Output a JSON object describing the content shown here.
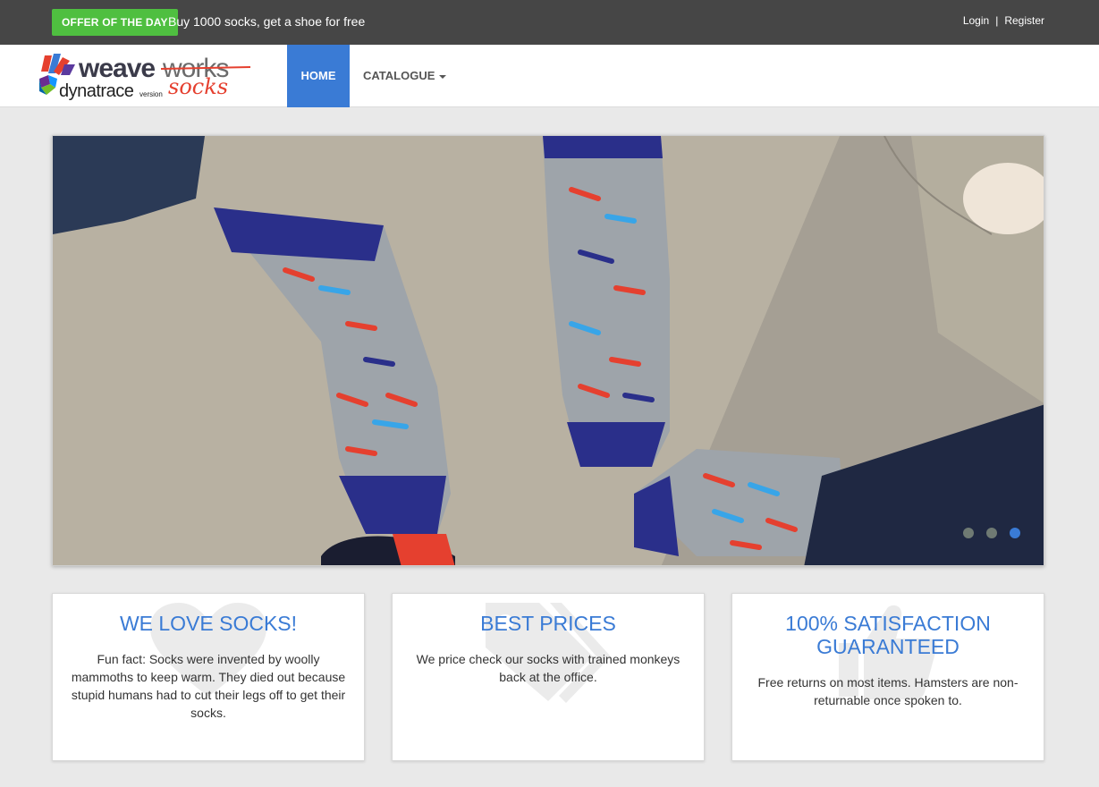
{
  "topbar": {
    "offer_label": "Offer of the day",
    "offer_text": "Buy 1000 socks, get a shoe for free",
    "login": "Login",
    "separator": "|",
    "register": "Register"
  },
  "logo": {
    "brand": "weave",
    "brand_accent": "works",
    "partner": "dynatrace",
    "partner_suffix": "version",
    "product": "socks"
  },
  "nav": {
    "home": "Home",
    "catalogue": "Catalogue"
  },
  "carousel": {
    "slide_count": 3,
    "active_slide": 3
  },
  "features": [
    {
      "title": "We love socks!",
      "text": "Fun fact: Socks were invented by woolly mammoths to keep warm. They died out because stupid humans had to cut their legs off to get their socks.",
      "icon": "heart-icon"
    },
    {
      "title": "Best prices",
      "text": "We price check our socks with trained monkeys back at the office.",
      "icon": "tags-icon"
    },
    {
      "title": "100% satisfaction guaranteed",
      "text": "Free returns on most items. Hamsters are non-returnable once spoken to.",
      "icon": "thumbs-up-icon"
    }
  ],
  "colors": {
    "accent": "#3a7bd5",
    "offer": "#4fbf40",
    "topbar": "#464646"
  }
}
